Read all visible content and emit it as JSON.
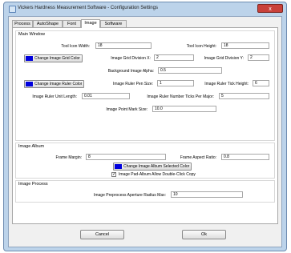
{
  "window": {
    "title": "Vickers Hardness Measurement Software - Configuration Settings",
    "close_glyph": "x"
  },
  "tabs": [
    {
      "label": "Process",
      "active": false
    },
    {
      "label": "AutoShape",
      "active": false
    },
    {
      "label": "Font",
      "active": false
    },
    {
      "label": "Image",
      "active": true
    },
    {
      "label": "Software",
      "active": false
    }
  ],
  "main_window": {
    "title": "Main Window",
    "tool_icon_width_label": "Tool Icon Width:",
    "tool_icon_width": "18",
    "tool_icon_height_label": "Tool Icon Height:",
    "tool_icon_height": "18",
    "grid_color_button": "Change Image Grid Color",
    "grid_color": "#0000dd",
    "grid_div_x_label": "Image Grid Division X:",
    "grid_div_x": "2",
    "grid_div_y_label": "Image Grid Division Y:",
    "grid_div_y": "2",
    "bg_alpha_label": "Background Image Alpha:",
    "bg_alpha": "0.5",
    "ruler_color_button": "Change Image Ruler Color",
    "ruler_color": "#0000dd",
    "ruler_pen_label": "Image Ruler Pen Size:",
    "ruler_pen": "1",
    "ruler_tick_label": "Image Ruler Tick Height:",
    "ruler_tick": "6",
    "ruler_unit_label": "Image Ruler Unit Length:",
    "ruler_unit": "0.01",
    "ruler_ticks_major_label": "Image Ruler Number Ticks Per Major:",
    "ruler_ticks_major": "5",
    "point_mark_label": "Image Point Mark Size:",
    "point_mark": "10.0"
  },
  "image_album": {
    "title": "Image Album",
    "frame_margin_label": "Frame Margin:",
    "frame_margin": "8",
    "frame_aspect_label": "Frame Aspect Ratio:",
    "frame_aspect": "0.8",
    "selected_color_button": "Change Image Album Selected Color",
    "selected_color": "#0000dd",
    "allow_dblclick_label": "Image Pad-Album Allow Double-Click Copy",
    "allow_dblclick_checked": true
  },
  "image_process": {
    "title": "Image Process",
    "aperture_label": "Image Preprocess Aperture Radius Max:",
    "aperture": "10"
  },
  "buttons": {
    "cancel": "Cancel",
    "ok": "Ok"
  }
}
